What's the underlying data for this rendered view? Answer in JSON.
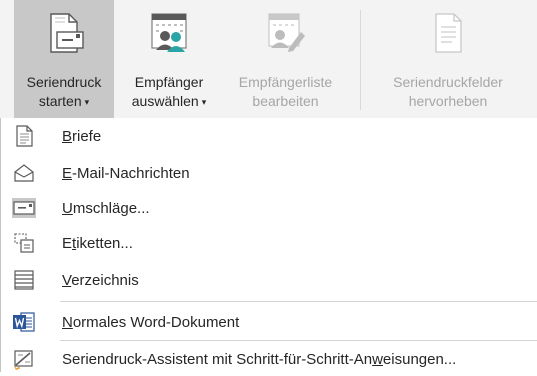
{
  "ribbon": {
    "buttons": [
      {
        "label_line1": "Seriendruck",
        "label_line2": "starten",
        "has_caret": true,
        "state": "active",
        "icon": "start-mail-merge-icon"
      },
      {
        "label_line1": "Empfänger",
        "label_line2": "auswählen",
        "has_caret": true,
        "state": "enabled",
        "icon": "select-recipients-icon"
      },
      {
        "label_line1": "Empfängerliste",
        "label_line2": "bearbeiten",
        "has_caret": false,
        "state": "disabled",
        "icon": "edit-recipient-list-icon"
      },
      {
        "label_line1": "Seriendruckfelder",
        "label_line2": "hervorheben",
        "has_caret": false,
        "state": "disabled",
        "icon": "highlight-merge-fields-icon"
      }
    ],
    "caret_glyph": "▾"
  },
  "menu": {
    "items": [
      {
        "accel": "B",
        "rest": "riefe",
        "icon": "letters-icon"
      },
      {
        "accel": "E",
        "rest": "-Mail-Nachrichten",
        "icon": "email-icon"
      },
      {
        "accel": "U",
        "rest": "mschläge...",
        "icon": "envelopes-icon"
      },
      {
        "pre": "E",
        "accel": "t",
        "rest": "iketten...",
        "icon": "labels-icon"
      },
      {
        "accel": "V",
        "rest": "erzeichnis",
        "icon": "directory-icon"
      },
      {
        "accel": "N",
        "rest": "ormales Word-Dokument",
        "icon": "word-document-icon"
      },
      {
        "pre": "Seriendruck-Assistent mit Schritt-für-Schritt-An",
        "accel": "w",
        "rest": "eisungen...",
        "icon": "mail-merge-wizard-icon"
      }
    ]
  },
  "colors": {
    "ribbon_bg": "#f3f3f3",
    "active_bg": "#c8c8c8",
    "disabled_text": "#a6a6a6",
    "word_blue": "#2b579a",
    "people_teal": "#2aa4a4"
  }
}
